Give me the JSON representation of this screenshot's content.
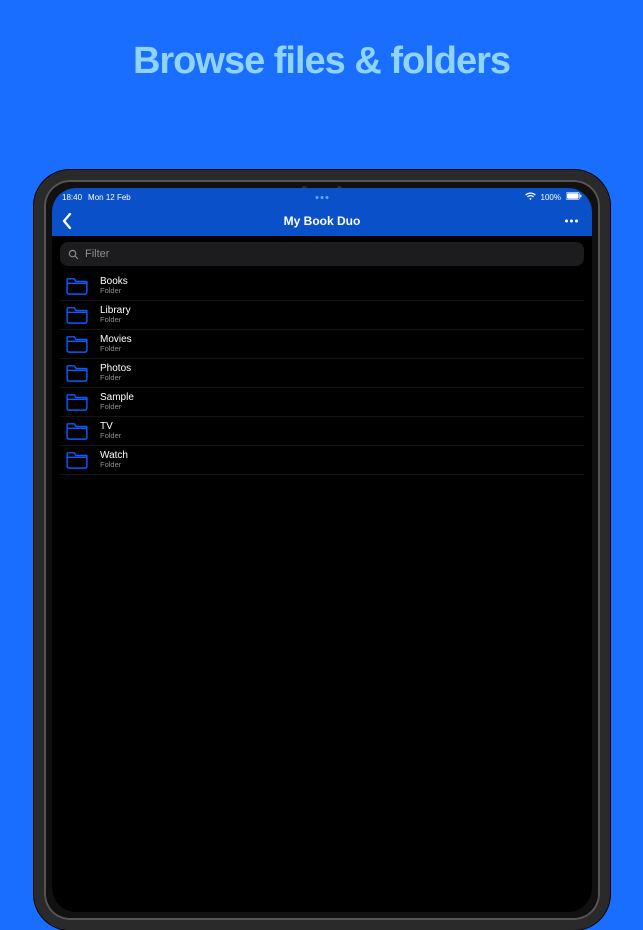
{
  "promo": {
    "title": "Browse files & folders"
  },
  "statusbar": {
    "time": "18:40",
    "date": "Mon 12 Feb",
    "battery": "100%"
  },
  "nav": {
    "title": "My Book Duo"
  },
  "search": {
    "placeholder": "Filter"
  },
  "folder_sub": "Folder",
  "items": [
    {
      "name": "Books"
    },
    {
      "name": "Library"
    },
    {
      "name": "Movies"
    },
    {
      "name": "Photos"
    },
    {
      "name": "Sample"
    },
    {
      "name": "TV"
    },
    {
      "name": "Watch"
    }
  ],
  "colors": {
    "background": "#1a6eff",
    "accent": "#0a50c8",
    "folder": "#0b5cff"
  }
}
